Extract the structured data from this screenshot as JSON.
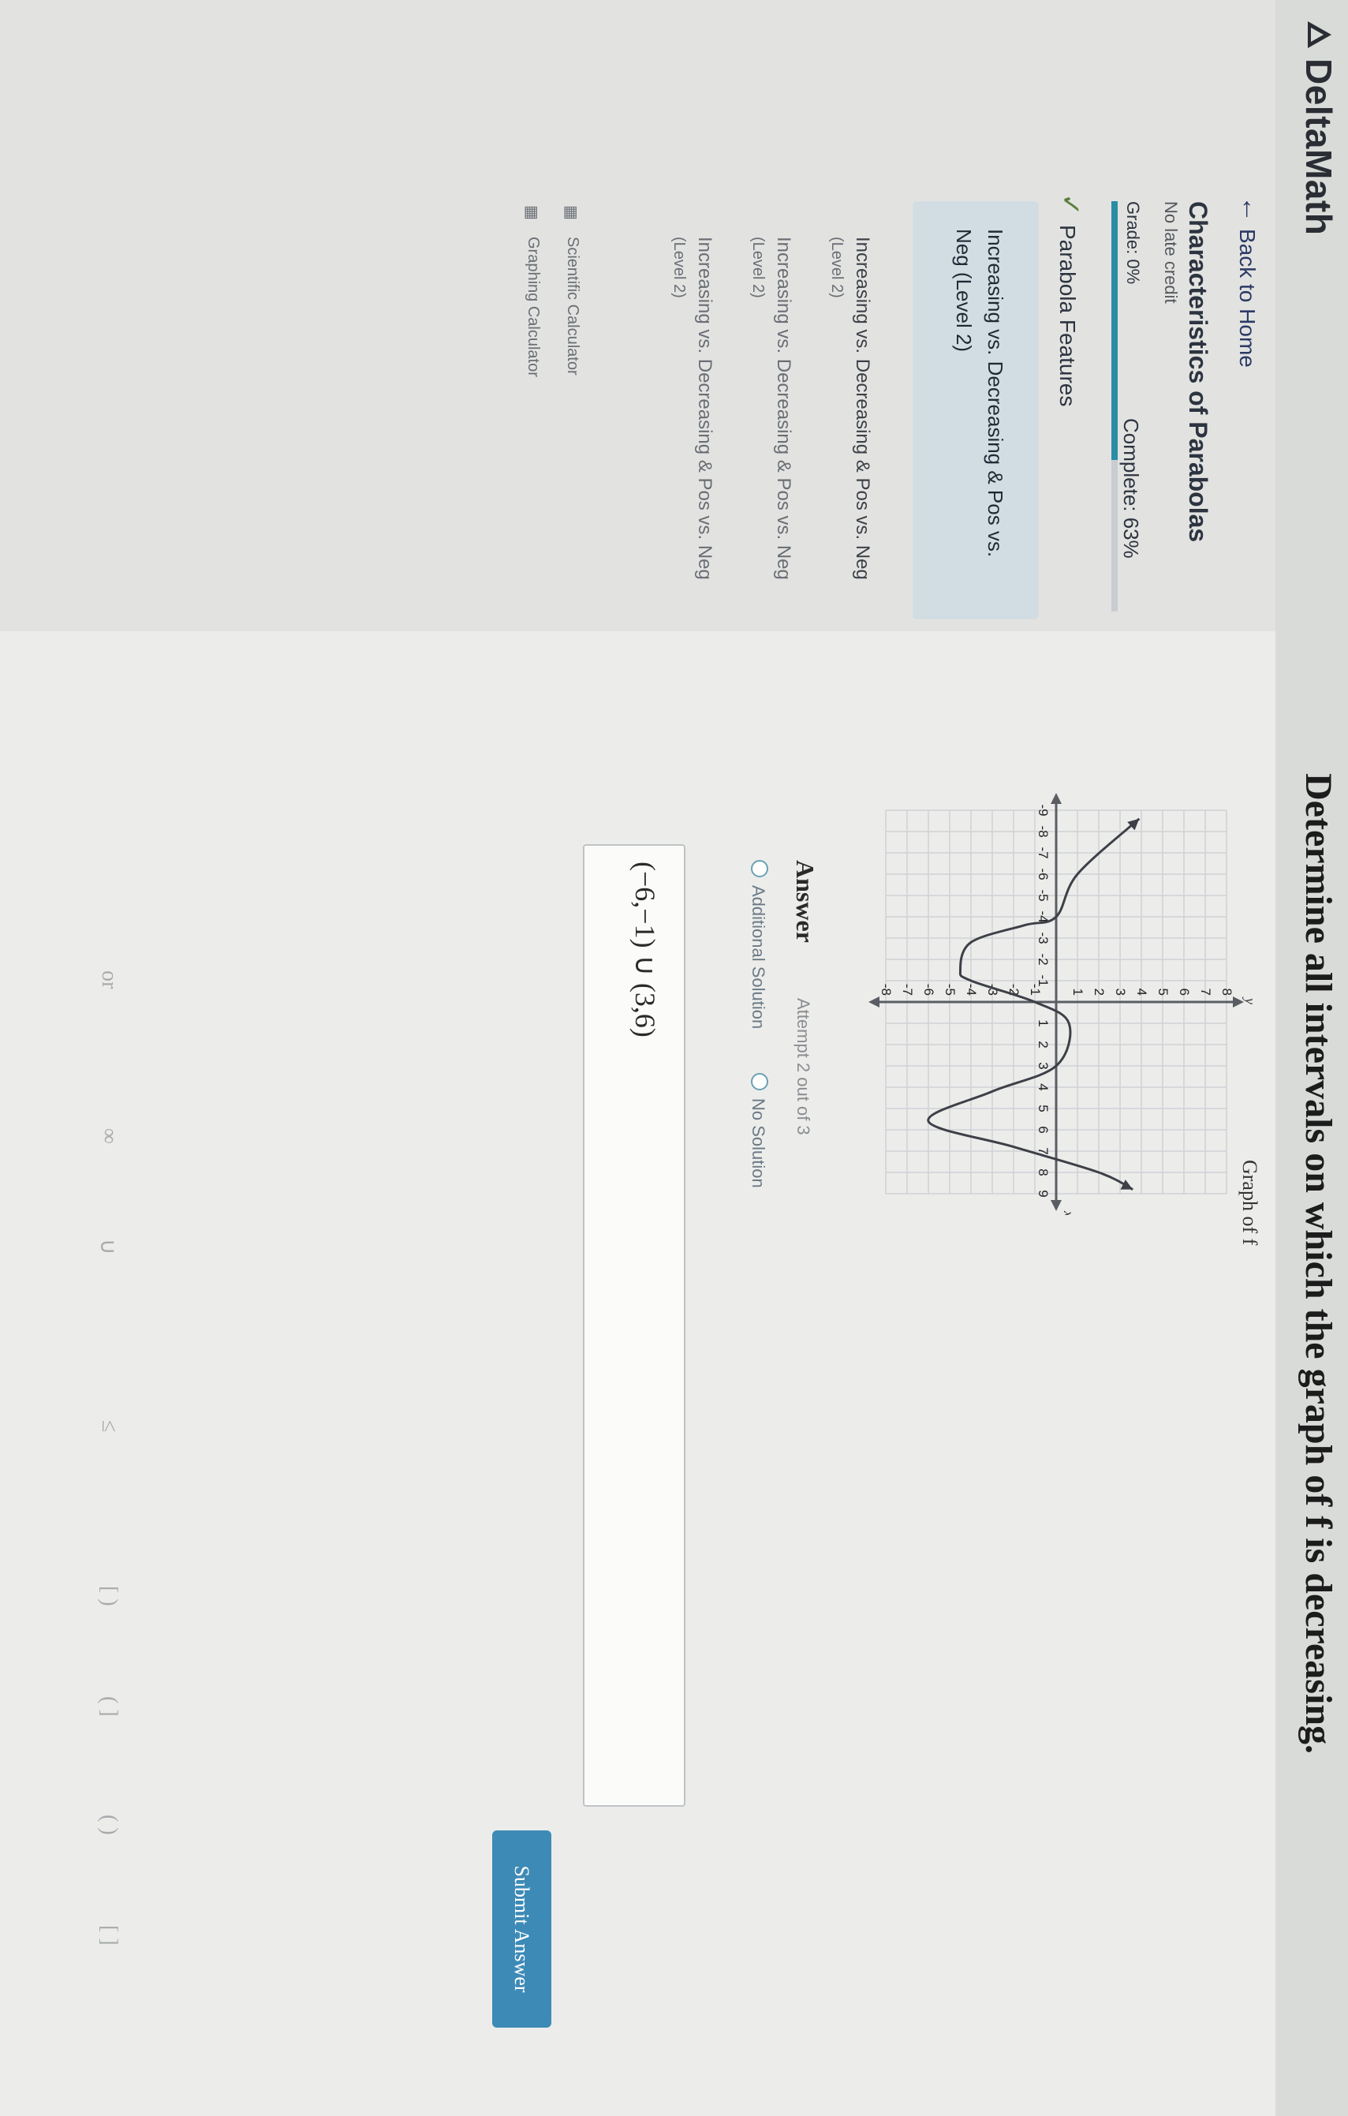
{
  "header": {
    "app_name": "DeltaMath"
  },
  "sidebar": {
    "back_label": "Back to Home",
    "course_title": "Characteristics of Parabolas",
    "no_credit": "No late credit",
    "grade": "Grade: 0%",
    "complete": "Complete: 63%",
    "progress": 0.63,
    "completed_item": "Parabola Features",
    "active_item_line1": "Increasing vs. Decreasing & Pos vs.",
    "active_item_line2": "Neg (Level 2)",
    "items": [
      {
        "label": "Increasing vs. Decreasing & Pos vs. Neg",
        "sub": "(Level 2)"
      },
      {
        "label": "Increasing vs. Decreasing & Pos vs. Neg",
        "sub": "(Level 2)"
      },
      {
        "label": "Increasing vs. Decreasing & Pos vs. Neg",
        "sub": "(Level 2)"
      }
    ],
    "tools": [
      "Scientific Calculator",
      "Graphing Calculator"
    ]
  },
  "question": {
    "text": "Determine all intervals on which the graph of f is decreasing.",
    "graph_title": "Graph of f"
  },
  "chart_data": {
    "type": "line",
    "xlabel": "x",
    "ylabel": "y",
    "xlim": [
      -9,
      9
    ],
    "ylim": [
      -8,
      8
    ],
    "x_ticks": [
      -9,
      -8,
      -7,
      -6,
      -5,
      -4,
      -3,
      -2,
      -1,
      1,
      2,
      3,
      4,
      5,
      6,
      7,
      8,
      9
    ],
    "y_ticks": [
      8,
      7,
      6,
      5,
      4,
      3,
      2,
      1,
      -1,
      -2,
      -3,
      -4,
      -5,
      -6,
      -7,
      -8
    ],
    "grid": true,
    "series": [
      {
        "values_xy": [
          [
            -8.6,
            3.9
          ],
          [
            -6,
            1
          ],
          [
            -4,
            0
          ],
          [
            -3.6,
            -1.5
          ],
          [
            -2.8,
            -4
          ],
          [
            -1.5,
            -4.5
          ],
          [
            -1,
            -4
          ],
          [
            0,
            -1
          ],
          [
            1,
            0.6
          ],
          [
            3,
            0
          ],
          [
            4.2,
            -3
          ],
          [
            5.6,
            -6
          ],
          [
            6.8,
            -2
          ],
          [
            8,
            2
          ],
          [
            8.8,
            3.6
          ]
        ],
        "endpoint_arrows": true
      }
    ]
  },
  "answer": {
    "label": "Answer",
    "attempt": "Attempt 2 out of 3",
    "option_additional": "Additional Solution",
    "option_none": "No Solution",
    "value": "(−6,−1) ∪ (3,6)",
    "submit_label": "Submit Answer"
  },
  "keypad": {
    "keys": [
      "or",
      "∞",
      "∪",
      "≤",
      "[  )",
      "(  ]",
      "(  )",
      "[  ]"
    ]
  }
}
